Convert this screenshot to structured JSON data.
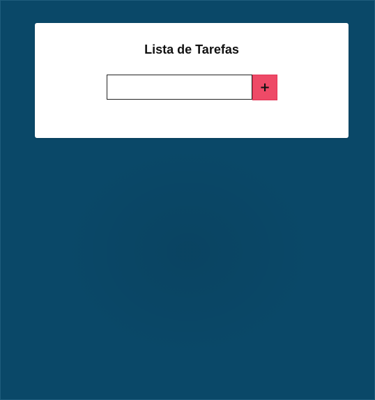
{
  "app": {
    "title": "Lista de Tarefas"
  },
  "form": {
    "input_value": "",
    "input_placeholder": "",
    "add_button_label": "+",
    "add_button_icon": "plus-icon"
  },
  "colors": {
    "background": "#0a4868",
    "card": "#ffffff",
    "add_button": "#ee4a67"
  }
}
